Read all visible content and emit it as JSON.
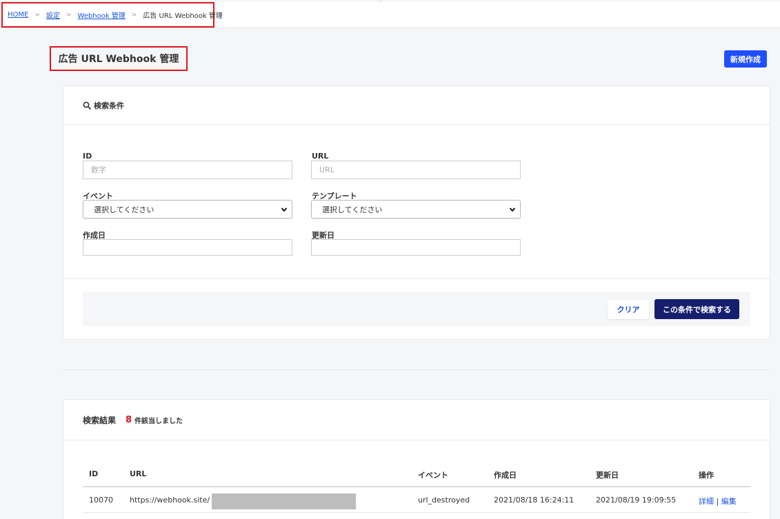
{
  "breadcrumb": {
    "items": [
      {
        "label": "HOME"
      },
      {
        "label": "設定"
      },
      {
        "label": "Webhook 管理"
      }
    ],
    "separator": ">",
    "current": "広告 URL Webhook 管理"
  },
  "page": {
    "title": "広告 URL Webhook 管理",
    "new_button": "新規作成"
  },
  "search": {
    "title": "検索条件",
    "fields": {
      "id": {
        "label": "ID",
        "placeholder": "数字",
        "value": ""
      },
      "url": {
        "label": "URL",
        "placeholder": "URL",
        "value": ""
      },
      "event": {
        "label": "イベント",
        "selected": "選択してください"
      },
      "template": {
        "label": "テンプレート",
        "selected": "選択してください"
      },
      "created": {
        "label": "作成日",
        "value": ""
      },
      "updated": {
        "label": "更新日",
        "value": ""
      }
    },
    "clear_button": "クリア",
    "search_button": "この条件で検索する"
  },
  "results": {
    "title": "検索結果",
    "count": "8",
    "count_suffix": "件該当しました",
    "columns": [
      "ID",
      "URL",
      "イベント",
      "作成日",
      "更新日",
      "操作"
    ],
    "rows": [
      {
        "id": "10070",
        "url": "https://webhook.site/",
        "event": "url_destroyed",
        "created": "2021/08/18 16:24:11",
        "updated": "2021/08/19 19:09:55",
        "detail": "詳細",
        "sep": "|",
        "edit": "編集"
      }
    ]
  },
  "colors": {
    "accent": "#1f4fff",
    "primary_dark": "#161f6e",
    "highlight_red": "#e0141c",
    "link": "#1a56db"
  },
  "icons": {
    "search": "search-icon",
    "select": "chevron-down-icon"
  }
}
